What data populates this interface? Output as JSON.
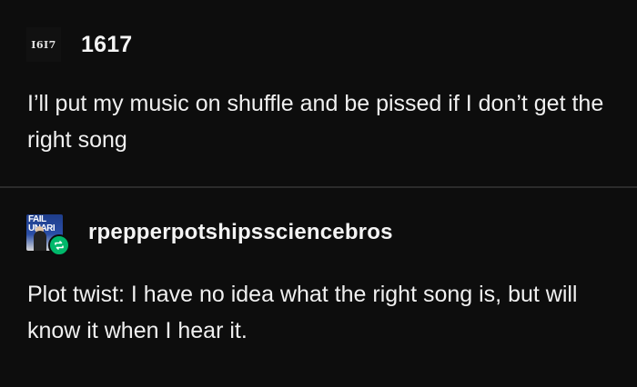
{
  "posts": [
    {
      "avatar_text": "I6I7",
      "username": "1617",
      "text": "I’ll put my music on shuffle and be pissed if I don’t get the right song"
    },
    {
      "avatar_text": "FAIL UNARI",
      "username": "rpepperpotshipssciencebros",
      "text": "Plot twist: I have no idea what the right song is, but will know it when I hear it.",
      "badge_icon": "reblog-icon"
    }
  ],
  "colors": {
    "background": "#0d0d0d",
    "text": "#f0f0f0",
    "divider": "#2b2b2b",
    "reblog_badge": "#00b86b"
  }
}
